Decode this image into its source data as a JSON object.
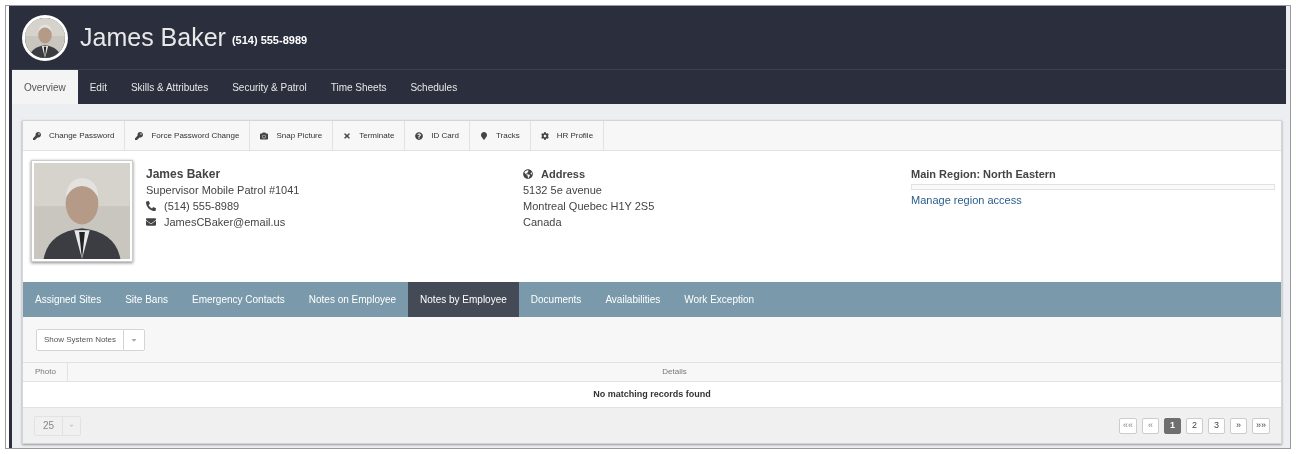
{
  "header": {
    "name": "James Baker",
    "phone": "(514) 555-8989"
  },
  "tabs": [
    {
      "label": "Overview",
      "selected": true
    },
    {
      "label": "Edit",
      "selected": false
    },
    {
      "label": "Skills & Attributes",
      "selected": false
    },
    {
      "label": "Security & Patrol",
      "selected": false
    },
    {
      "label": "Time Sheets",
      "selected": false
    },
    {
      "label": "Schedules",
      "selected": false
    }
  ],
  "toolbar": [
    {
      "label": "Change Password",
      "kind": "key"
    },
    {
      "label": "Force Password Change",
      "kind": "key"
    },
    {
      "label": "Snap Picture",
      "kind": "camera"
    },
    {
      "label": "Terminate",
      "kind": "cross"
    },
    {
      "label": "ID Card",
      "kind": "question"
    },
    {
      "label": "Tracks",
      "kind": "pin"
    },
    {
      "label": "HR Profile",
      "kind": "gear"
    }
  ],
  "profile": {
    "name": "James Baker",
    "title": "Supervisor Mobile Patrol #1041",
    "phone": "(514) 555-8989",
    "email": "JamesCBaker@email.us"
  },
  "address": {
    "heading": "Address",
    "lines": [
      "5132 5e avenue",
      "Montreal Quebec H1Y 2S5",
      "Canada"
    ]
  },
  "region": {
    "heading": "Main Region: North Eastern",
    "link": "Manage region access"
  },
  "sub_tabs": [
    {
      "label": "Assigned Sites",
      "selected": false
    },
    {
      "label": "Site Bans",
      "selected": false
    },
    {
      "label": "Emergency Contacts",
      "selected": false
    },
    {
      "label": "Notes on Employee",
      "selected": false
    },
    {
      "label": "Notes by Employee",
      "selected": true
    },
    {
      "label": "Documents",
      "selected": false
    },
    {
      "label": "Availabilities",
      "selected": false
    },
    {
      "label": "Work Exception",
      "selected": false
    }
  ],
  "filter_button": "Show System Notes",
  "table": {
    "columns": [
      "Photo",
      "Details"
    ],
    "empty_message": "No matching records found"
  },
  "page_size": "25",
  "pagination": [
    {
      "label": "««",
      "selected": false,
      "disabled": true
    },
    {
      "label": "«",
      "selected": false,
      "disabled": true
    },
    {
      "label": "1",
      "selected": true,
      "disabled": false
    },
    {
      "label": "2",
      "selected": false,
      "disabled": false
    },
    {
      "label": "3",
      "selected": false,
      "disabled": false
    },
    {
      "label": "»",
      "selected": false,
      "disabled": false
    },
    {
      "label": "»»",
      "selected": false,
      "disabled": false
    }
  ]
}
